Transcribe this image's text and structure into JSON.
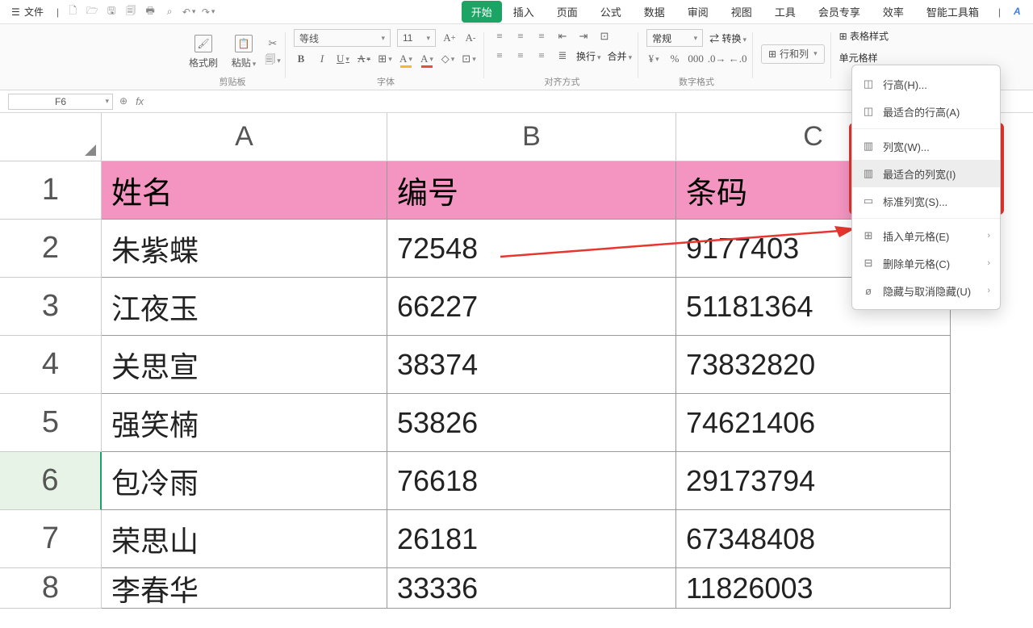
{
  "menu": {
    "file": "文件",
    "tabs": [
      "开始",
      "插入",
      "页面",
      "公式",
      "数据",
      "审阅",
      "视图",
      "工具",
      "会员专享",
      "效率",
      "智能工具箱"
    ],
    "active_tab": "开始"
  },
  "ribbon": {
    "clipboard": {
      "fmt_painter": "格式刷",
      "paste": "粘贴",
      "label": "剪贴板"
    },
    "font": {
      "name": "等线",
      "size": "11",
      "label": "字体",
      "bold": "B",
      "italic": "I",
      "underline": "U",
      "strike": "S",
      "increase": "A",
      "decrease": "A"
    },
    "align": {
      "label": "对齐方式",
      "wrap": "换行",
      "merge": "合并"
    },
    "number": {
      "fmt": "常规",
      "label": "数字格式",
      "convert": "转换"
    },
    "rows_cols": {
      "btn": "行和列"
    },
    "table_style": "表格样式",
    "cell_style": "单元格样"
  },
  "fx": {
    "cell_ref": "F6",
    "fx": "fx"
  },
  "sheet": {
    "cols": [
      "A",
      "B",
      "C"
    ],
    "row_nums": [
      "1",
      "2",
      "3",
      "4",
      "5",
      "6",
      "7",
      "8"
    ],
    "active_row": 6,
    "header": [
      "姓名",
      "编号",
      "条码"
    ],
    "rows": [
      [
        "朱紫蝶",
        "72548",
        "9177403"
      ],
      [
        "江夜玉",
        "66227",
        "51181364"
      ],
      [
        "关思宣",
        "38374",
        "73832820"
      ],
      [
        "强笑楠",
        "53826",
        "74621406"
      ],
      [
        "包冷雨",
        "76618",
        "29173794"
      ],
      [
        "荣思山",
        "26181",
        "67348408"
      ],
      [
        "李春华",
        "33336",
        "11826003"
      ]
    ]
  },
  "dropdown": {
    "items": [
      {
        "label": "行高(H)...",
        "ico": "⊟"
      },
      {
        "label": "最适合的行高(A)",
        "ico": "⊟"
      },
      {
        "sep": true
      },
      {
        "label": "列宽(W)...",
        "ico": "⊞"
      },
      {
        "label": "最适合的列宽(I)",
        "ico": "⊞",
        "hover": true
      },
      {
        "label": "标准列宽(S)...",
        "ico": "⊟"
      },
      {
        "sep": true
      },
      {
        "label": "插入单元格(E)",
        "ico": "⊞",
        "sub": true
      },
      {
        "label": "删除单元格(C)",
        "ico": "⊟",
        "sub": true
      },
      {
        "label": "隐藏与取消隐藏(U)",
        "ico": "ø",
        "sub": true
      }
    ]
  }
}
